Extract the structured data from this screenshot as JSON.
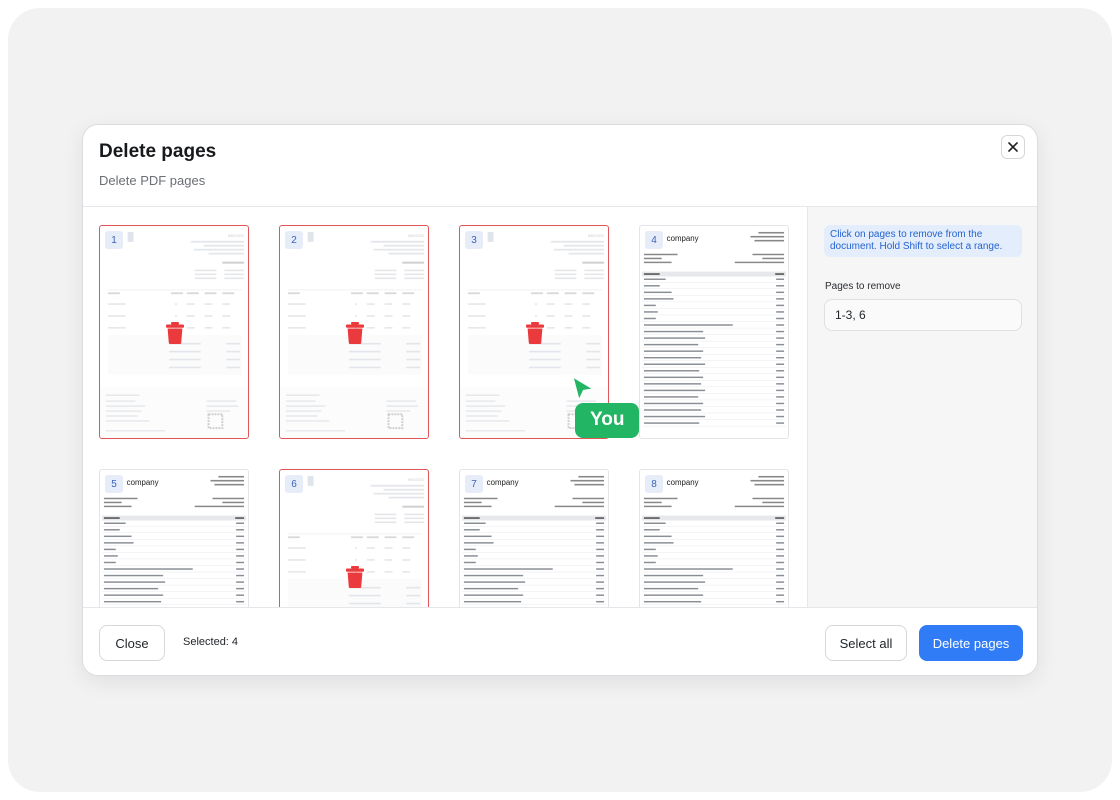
{
  "dialog": {
    "title": "Delete pages",
    "subtitle": "Delete PDF pages"
  },
  "pages": [
    {
      "number": "1",
      "selected": true,
      "kind": "invoice"
    },
    {
      "number": "2",
      "selected": true,
      "kind": "invoice"
    },
    {
      "number": "3",
      "selected": true,
      "kind": "invoice"
    },
    {
      "number": "4",
      "selected": false,
      "kind": "company"
    },
    {
      "number": "5",
      "selected": false,
      "kind": "company"
    },
    {
      "number": "6",
      "selected": true,
      "kind": "invoice"
    },
    {
      "number": "7",
      "selected": false,
      "kind": "company"
    },
    {
      "number": "8",
      "selected": false,
      "kind": "company"
    }
  ],
  "page_content": {
    "company_name": "company",
    "invoice_heading": "INVOICE"
  },
  "sidebar": {
    "hint": "Click on pages to remove from the document. Hold Shift to select a range.",
    "field_label": "Pages to remove",
    "field_value": "1-3, 6"
  },
  "cursor": {
    "label": "You"
  },
  "footer": {
    "close_label": "Close",
    "selected_text": "Selected: 4",
    "select_all_label": "Select all",
    "delete_label": "Delete pages"
  },
  "colors": {
    "accent": "#2f7cf6",
    "selected_border": "#e25457",
    "trash": "#ea3a3d",
    "cursor": "#22b664"
  },
  "icons": {
    "close": "close-icon",
    "trash": "trash-icon",
    "cursor": "cursor-arrow-icon"
  }
}
